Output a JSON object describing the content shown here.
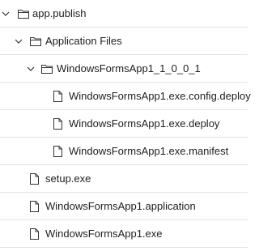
{
  "tree": {
    "items": [
      {
        "label": "app.publish",
        "type": "folder",
        "expanded": true,
        "icon": "folder-icon",
        "chevron": "chevron-down-icon"
      },
      {
        "label": "Application Files",
        "type": "folder",
        "expanded": true,
        "icon": "folder-icon",
        "chevron": "chevron-down-icon"
      },
      {
        "label": "WindowsFormsApp1_1_0_0_1",
        "type": "folder",
        "expanded": true,
        "icon": "folder-icon",
        "chevron": "chevron-down-icon"
      },
      {
        "label": "WindowsFormsApp1.exe.config.deploy",
        "type": "file",
        "icon": "file-icon"
      },
      {
        "label": "WindowsFormsApp1.exe.deploy",
        "type": "file",
        "icon": "file-icon"
      },
      {
        "label": "WindowsFormsApp1.exe.manifest",
        "type": "file",
        "icon": "file-icon"
      },
      {
        "label": "setup.exe",
        "type": "file",
        "icon": "file-icon"
      },
      {
        "label": "WindowsFormsApp1.application",
        "type": "file",
        "icon": "file-icon"
      },
      {
        "label": "WindowsFormsApp1.exe",
        "type": "file",
        "icon": "file-icon"
      }
    ]
  }
}
